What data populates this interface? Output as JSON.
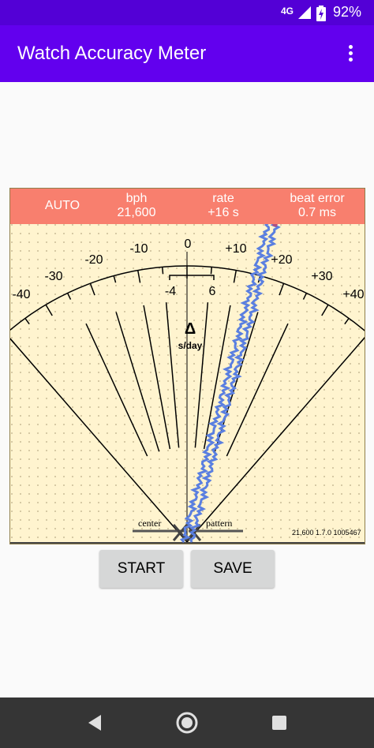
{
  "status_bar": {
    "network": "4G",
    "battery_pct": "92%"
  },
  "app_bar": {
    "title": "Watch Accuracy Meter",
    "menu_icon": "more-vert-icon"
  },
  "meter": {
    "mode": "AUTO",
    "bph_label": "bph",
    "bph_value": "21,600",
    "rate_label": "rate",
    "rate_value": "+16 s",
    "beat_label": "beat error",
    "beat_value": "0.7 ms",
    "scale": {
      "outer": [
        "-40",
        "-30",
        "-20",
        "-10",
        "0",
        "+10",
        "+20",
        "+30",
        "+40"
      ],
      "inner": [
        "-4",
        "6"
      ]
    },
    "delta_symbol": "Δ",
    "delta_unit": "s/day",
    "center_label": "center",
    "pattern_label": "pattern",
    "version": "21,600 1.7.0 1005467",
    "colors": {
      "header": "#f87f6e",
      "background": "#fff4cf",
      "trace": "#5a7fe0",
      "trace_top": "#b05080"
    }
  },
  "buttons": {
    "start": "START",
    "save": "SAVE"
  },
  "nav": {
    "back": "back-icon",
    "home": "home-icon",
    "recent": "recent-apps-icon"
  }
}
